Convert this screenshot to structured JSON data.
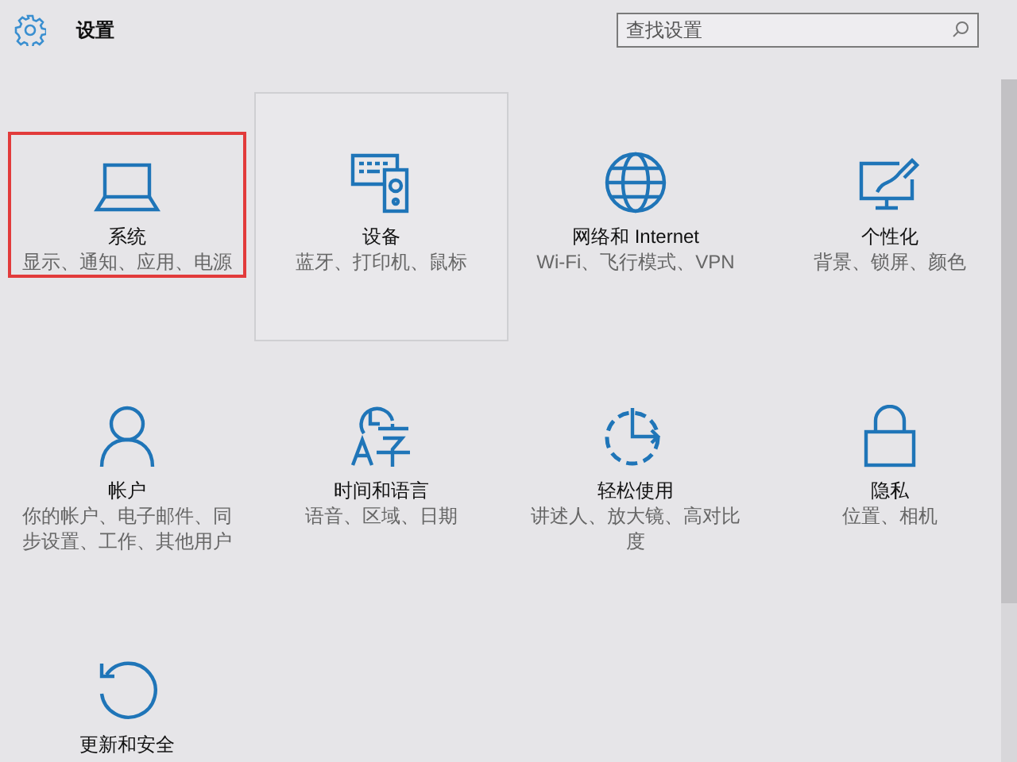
{
  "window": {
    "title": "设置"
  },
  "search": {
    "placeholder": "查找设置"
  },
  "tiles": [
    {
      "kind": "laptop",
      "title": "系统",
      "subtitle": "显示、通知、应用、电源",
      "selected": true,
      "hovered": false
    },
    {
      "kind": "devices",
      "title": "设备",
      "subtitle": "蓝牙、打印机、鼠标",
      "selected": false,
      "hovered": true
    },
    {
      "kind": "globe",
      "title": "网络和 Internet",
      "subtitle": "Wi-Fi、飞行模式、VPN",
      "selected": false,
      "hovered": false
    },
    {
      "kind": "paint",
      "title": "个性化",
      "subtitle": "背景、锁屏、颜色",
      "selected": false,
      "hovered": false
    },
    {
      "kind": "person",
      "title": "帐户",
      "subtitle": "你的帐户、电子邮件、同步设置、工作、其他用户",
      "selected": false,
      "hovered": false
    },
    {
      "kind": "timelang",
      "title": "时间和语言",
      "subtitle": "语音、区域、日期",
      "selected": false,
      "hovered": false
    },
    {
      "kind": "ease",
      "title": "轻松使用",
      "subtitle": "讲述人、放大镜、高对比度",
      "selected": false,
      "hovered": false
    },
    {
      "kind": "lock",
      "title": "隐私",
      "subtitle": "位置、相机",
      "selected": false,
      "hovered": false
    },
    {
      "kind": "update",
      "title": "更新和安全",
      "selected": false,
      "hovered": false
    }
  ]
}
